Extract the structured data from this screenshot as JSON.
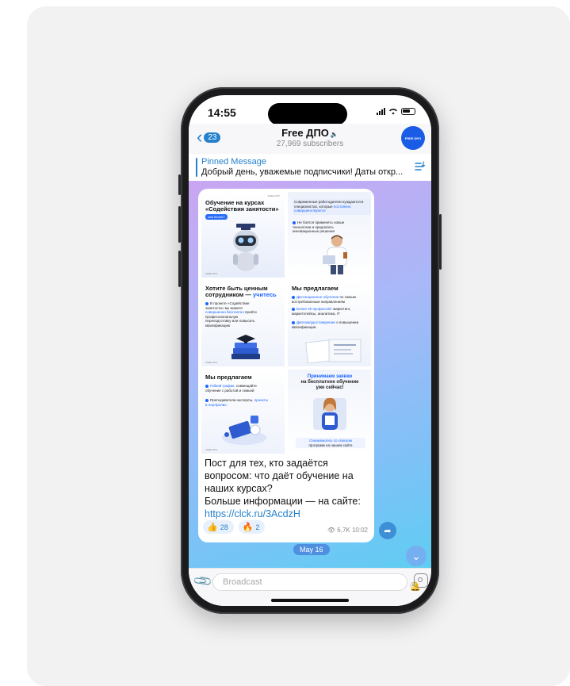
{
  "status": {
    "time": "14:55"
  },
  "header": {
    "back_count": "23",
    "channel_name": "Free ДПО",
    "subscribers": "27,969 subscribers",
    "avatar_text": "FREE DPO"
  },
  "pinned": {
    "label": "Pinned Message",
    "text": "Добрый день, уважемые подписчики! Даты откр..."
  },
  "collage": {
    "tile1": {
      "title_a": "Обучение на курсах",
      "title_b": "«Содействия занятости»",
      "pill": "чем белее?",
      "logo": "FREE DPO"
    },
    "tile2": {
      "intro_a": "Современные работодатели",
      "intro_b": "нуждаются в специалистах,",
      "intro_c": "которые",
      "intro_hl": "постоянно совершенствуются",
      "bullet": "Не боятся применять новые технологии и предлагать инновационные решения"
    },
    "tile3": {
      "title_a": "Хотите быть ценным",
      "title_b": "сотрудником —",
      "title_hl": "учитесь",
      "text_a": "В проекте «Содействие занятости» вы можете",
      "text_hl": "совершенно бесплатно",
      "text_b": "пройти профессиональную переподготовку или повысить квалификацию"
    },
    "tile4": {
      "title": "Мы предлагаем",
      "b1_hl": "Дистанционное обучение",
      "b1": "по самым востребованным направлениям",
      "b2_hl": "Более 20 профессий:",
      "b2": "маркетинг, маркетплейсы, аналитика, IT",
      "b3_hl": "Диплом/удостоверение",
      "b3": "о повышении квалификации"
    },
    "tile5": {
      "title": "Мы предлагаем",
      "b1_hl": "Гибкий график,",
      "b1": "совмещайте обучение с работой и семьей",
      "b2": "Преподаватели-эксперты,",
      "b2_hl": "проекты в портфолио"
    },
    "tile6": {
      "title_hl": "Принимаем заявки",
      "title_a": "на бесплатное обучение",
      "title_b": "уже сейчас!",
      "cta_hl": "Ознакомьтесь со списком",
      "cta": "программ на нашем сайте"
    }
  },
  "post": {
    "line1": "Пост для тех, кто задаётся",
    "line2": "вопросом: что даёт обучение на",
    "line3": "наших курсах?",
    "line4": "Больше информации — на сайте:",
    "link": "https://clck.ru/3AcdzH",
    "reactions": [
      {
        "emoji": "👍",
        "count": "28"
      },
      {
        "emoji": "🔥",
        "count": "2"
      }
    ],
    "views_time": "6,7K 10:02"
  },
  "date_chip": "May 16",
  "input": {
    "placeholder": "Broadcast"
  }
}
